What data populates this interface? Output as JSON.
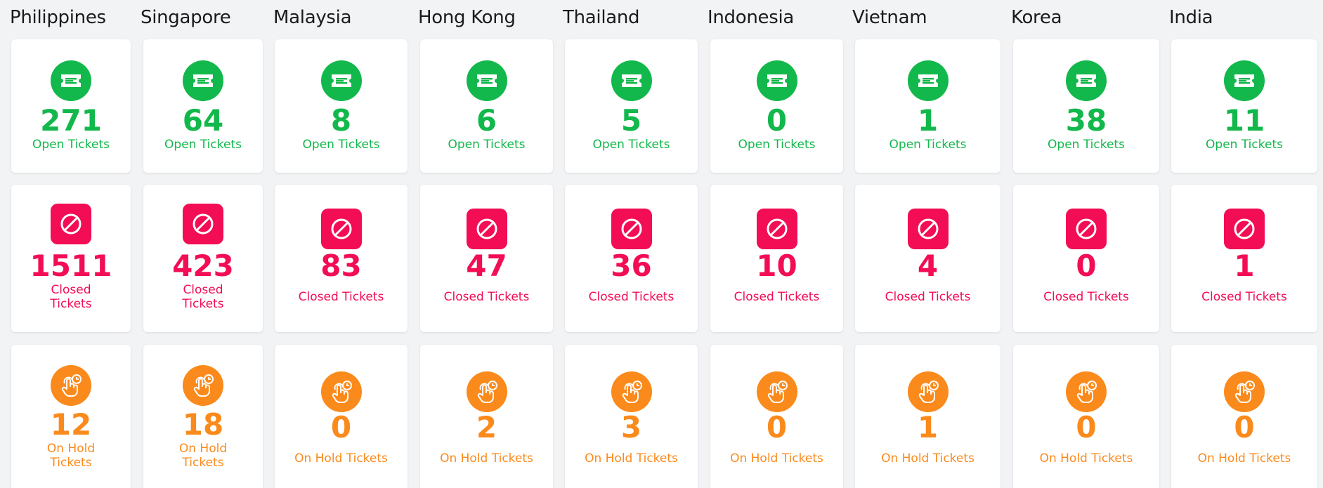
{
  "colors": {
    "open": "#12b84b",
    "closed": "#f20d55",
    "hold": "#fb8a1c"
  },
  "icons": {
    "open": "ticket-icon",
    "closed": "ban-icon",
    "hold": "hand-clock-icon"
  },
  "countries": [
    {
      "name": "Philippines",
      "open": {
        "value": "271",
        "label": "Open Tickets"
      },
      "closed": {
        "value": "1511",
        "label": "Closed Tickets"
      },
      "hold": {
        "value": "12",
        "label": "On Hold Tickets"
      }
    },
    {
      "name": "Singapore",
      "open": {
        "value": "64",
        "label": "Open Tickets"
      },
      "closed": {
        "value": "423",
        "label": "Closed Tickets"
      },
      "hold": {
        "value": "18",
        "label": "On Hold Tickets"
      }
    },
    {
      "name": "Malaysia",
      "open": {
        "value": "8",
        "label": "Open Tickets"
      },
      "closed": {
        "value": "83",
        "label": "Closed Tickets"
      },
      "hold": {
        "value": "0",
        "label": "On Hold Tickets"
      }
    },
    {
      "name": "Hong Kong",
      "open": {
        "value": "6",
        "label": "Open Tickets"
      },
      "closed": {
        "value": "47",
        "label": "Closed Tickets"
      },
      "hold": {
        "value": "2",
        "label": "On Hold Tickets"
      }
    },
    {
      "name": "Thailand",
      "open": {
        "value": "5",
        "label": "Open Tickets"
      },
      "closed": {
        "value": "36",
        "label": "Closed Tickets"
      },
      "hold": {
        "value": "3",
        "label": "On Hold Tickets"
      }
    },
    {
      "name": "Indonesia",
      "open": {
        "value": "0",
        "label": "Open Tickets"
      },
      "closed": {
        "value": "10",
        "label": "Closed Tickets"
      },
      "hold": {
        "value": "0",
        "label": "On Hold Tickets"
      }
    },
    {
      "name": "Vietnam",
      "open": {
        "value": "1",
        "label": "Open Tickets"
      },
      "closed": {
        "value": "4",
        "label": "Closed Tickets"
      },
      "hold": {
        "value": "1",
        "label": "On Hold Tickets"
      }
    },
    {
      "name": "Korea",
      "open": {
        "value": "38",
        "label": "Open Tickets"
      },
      "closed": {
        "value": "0",
        "label": "Closed Tickets"
      },
      "hold": {
        "value": "0",
        "label": "On Hold Tickets"
      }
    },
    {
      "name": "India",
      "open": {
        "value": "11",
        "label": "Open Tickets"
      },
      "closed": {
        "value": "1",
        "label": "Closed Tickets"
      },
      "hold": {
        "value": "0",
        "label": "On Hold Tickets"
      }
    }
  ]
}
